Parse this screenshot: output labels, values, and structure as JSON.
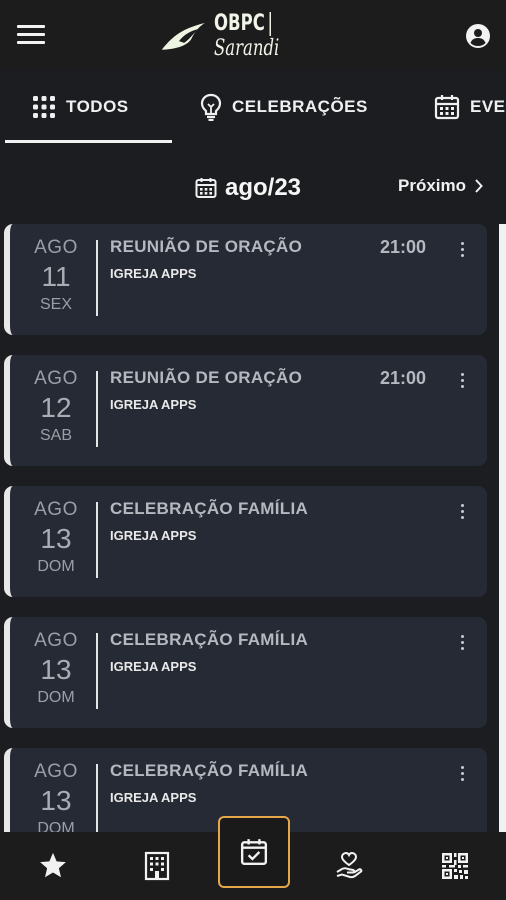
{
  "app": {
    "logo_text": "OBPC",
    "logo_script": "Sarandi"
  },
  "tabs": [
    {
      "label": "TODOS",
      "icon": "grid-icon",
      "active": true
    },
    {
      "label": "CELEBRAÇÕES",
      "icon": "lightbulb-icon",
      "active": false
    },
    {
      "label": "EVE",
      "icon": "calendar-icon",
      "active": false
    }
  ],
  "month_nav": {
    "current": "ago/23",
    "next_label": "Próximo"
  },
  "events": [
    {
      "month": "AGO",
      "day": "11",
      "weekday": "SEX",
      "title": "REUNIÃO DE ORAÇÃO",
      "org": "IGREJA APPS",
      "time": "21:00"
    },
    {
      "month": "AGO",
      "day": "12",
      "weekday": "SAB",
      "title": "REUNIÃO DE ORAÇÃO",
      "org": "IGREJA APPS",
      "time": "21:00"
    },
    {
      "month": "AGO",
      "day": "13",
      "weekday": "DOM",
      "title": "CELEBRAÇÃO FAMÍLIA",
      "org": "IGREJA APPS",
      "time": ""
    },
    {
      "month": "AGO",
      "day": "13",
      "weekday": "DOM",
      "title": "CELEBRAÇÃO FAMÍLIA",
      "org": "IGREJA APPS",
      "time": ""
    },
    {
      "month": "AGO",
      "day": "13",
      "weekday": "DOM",
      "title": "CELEBRAÇÃO FAMÍLIA",
      "org": "IGREJA APPS",
      "time": ""
    }
  ],
  "bottom_nav": [
    {
      "icon": "star-icon",
      "active": false
    },
    {
      "icon": "building-icon",
      "active": false
    },
    {
      "icon": "calendar-check-icon",
      "active": true
    },
    {
      "icon": "donation-hand-icon",
      "active": false
    },
    {
      "icon": "qr-code-icon",
      "active": false
    }
  ],
  "colors": {
    "background": "#1b1d21",
    "card": "#262a34",
    "active_outline": "#e6a64a",
    "logo": "#f0f4e8"
  }
}
